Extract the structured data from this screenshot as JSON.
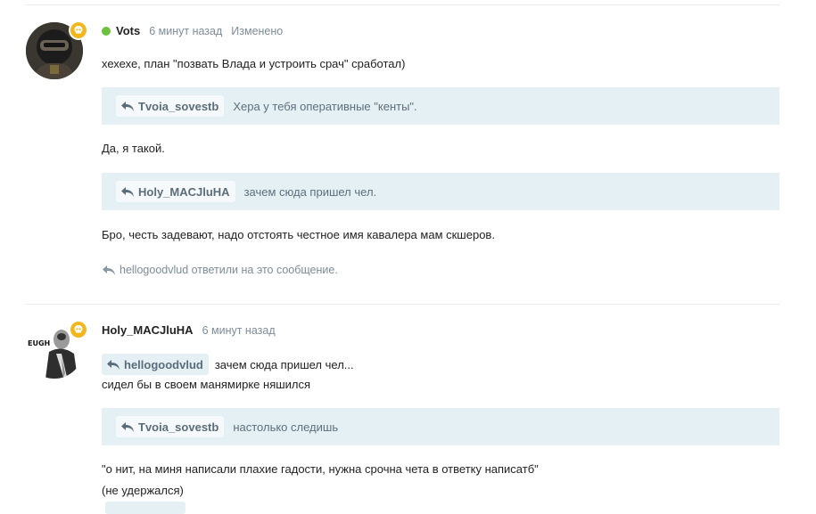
{
  "posts": [
    {
      "author": "Vots",
      "time": "6 минут назад",
      "edited": "Изменено",
      "online": true,
      "body_intro": "хехехе, план \"позвать Влада и устроить срач\" сработал)",
      "quotes": [
        {
          "user": "Tvoia_sovestb",
          "text": "Хера у тебя оперативные \"кенты\"."
        },
        {
          "user": "Holy_MACJluHA",
          "text": "зачем сюда пришел чел."
        }
      ],
      "reply_1": "Да, я такой.",
      "reply_2": "Бро, честь задевают, надо отстоять честное имя кавалера мам скшеров.",
      "replied_by": "hellogoodvlud ответили на это сообщение."
    },
    {
      "author": "Holy_MACJluHA",
      "time": "6 минут назад",
      "avatar_text": "EUGH",
      "inline_quote_user": "hellogoodvlud",
      "inline_quote_text": "зачем сюда пришел чел...",
      "line_2": "сидел бы в своем манямирке няшился",
      "quotes": [
        {
          "user": "Tvoia_sovestb",
          "text": "настолько следишь"
        }
      ],
      "line_3": "\"о нит, на миня написали плахие гадости, нужна срочна чета в ответку написатб\"",
      "line_4": "(не удержался)"
    }
  ],
  "icons": {
    "badge": "skull-icon",
    "reply": "reply-arrow-icon"
  },
  "colors": {
    "online": "#6cc23e",
    "badge": "#f2b720",
    "quote_bg": "#e5f0f4",
    "meta": "#7d8c99"
  }
}
